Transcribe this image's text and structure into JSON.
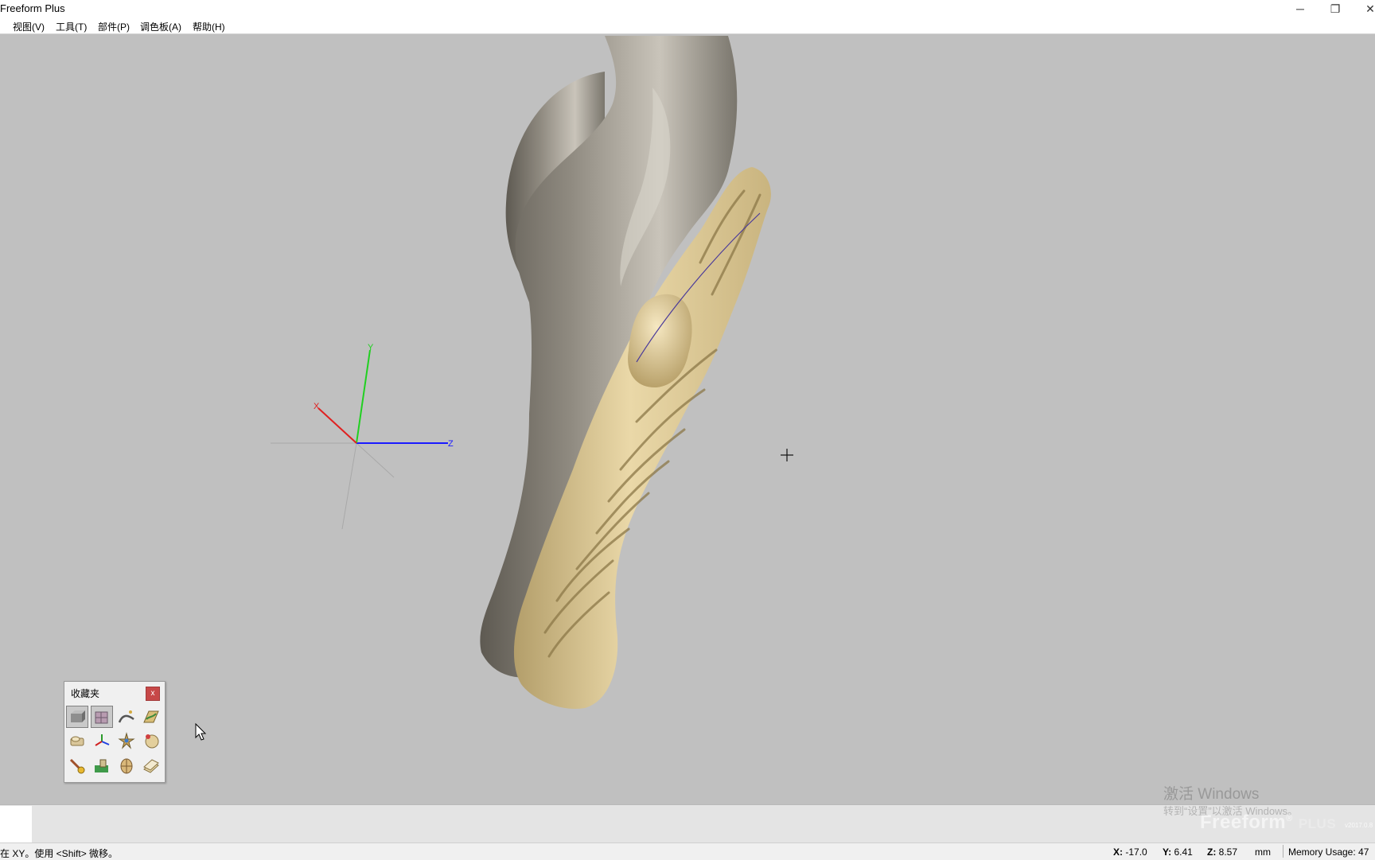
{
  "window": {
    "title": "Freeform Plus",
    "controls": {
      "minimize": "─",
      "restore": "❐",
      "close": "✕"
    }
  },
  "menu": {
    "items": [
      {
        "label": "视图(V)"
      },
      {
        "label": "工具(T)"
      },
      {
        "label": "部件(P)"
      },
      {
        "label": "调色板(A)"
      },
      {
        "label": "帮助(H)"
      }
    ]
  },
  "viewport": {
    "axes": {
      "x_label": "X",
      "y_label": "Y",
      "z_label": "Z",
      "x_color": "#e02020",
      "y_color": "#20d020",
      "z_color": "#1a1aff"
    },
    "model_colors": {
      "body": "#8a867c",
      "relief": "#e6d3a2"
    }
  },
  "palette": {
    "title": "收藏夹",
    "close_label": "x",
    "tools": [
      {
        "name": "select-block-tool-icon",
        "active": true
      },
      {
        "name": "select-grid-tool-icon",
        "active": true
      },
      {
        "name": "curve-tool-icon",
        "active": false
      },
      {
        "name": "sketch-plane-tool-icon",
        "active": false
      },
      {
        "name": "emboss-tool-icon",
        "active": false
      },
      {
        "name": "move-axes-tool-icon",
        "active": false
      },
      {
        "name": "star-deform-tool-icon",
        "active": false
      },
      {
        "name": "sculpt-ball-tool-icon",
        "active": false
      },
      {
        "name": "carve-tool-icon",
        "active": false
      },
      {
        "name": "smudge-tool-icon",
        "active": false
      },
      {
        "name": "detail-grid-tool-icon",
        "active": false
      },
      {
        "name": "layer-tool-icon",
        "active": false
      }
    ]
  },
  "watermark": {
    "activate_title": "激活 Windows",
    "activate_sub": "转到“设置”以激活 Windows。",
    "logo": "Freeform",
    "logo_reg": "®",
    "logo_plus": "PLUS",
    "version": "v2017.0.8"
  },
  "status": {
    "prompt": "在 XY。使用 <Shift> 微移。",
    "x_label": "X:",
    "x_value": "-17.0",
    "y_label": "Y:",
    "y_value": "6.41",
    "z_label": "Z:",
    "z_value": "8.57",
    "unit": "mm",
    "memory": "Memory Usage: 47"
  }
}
